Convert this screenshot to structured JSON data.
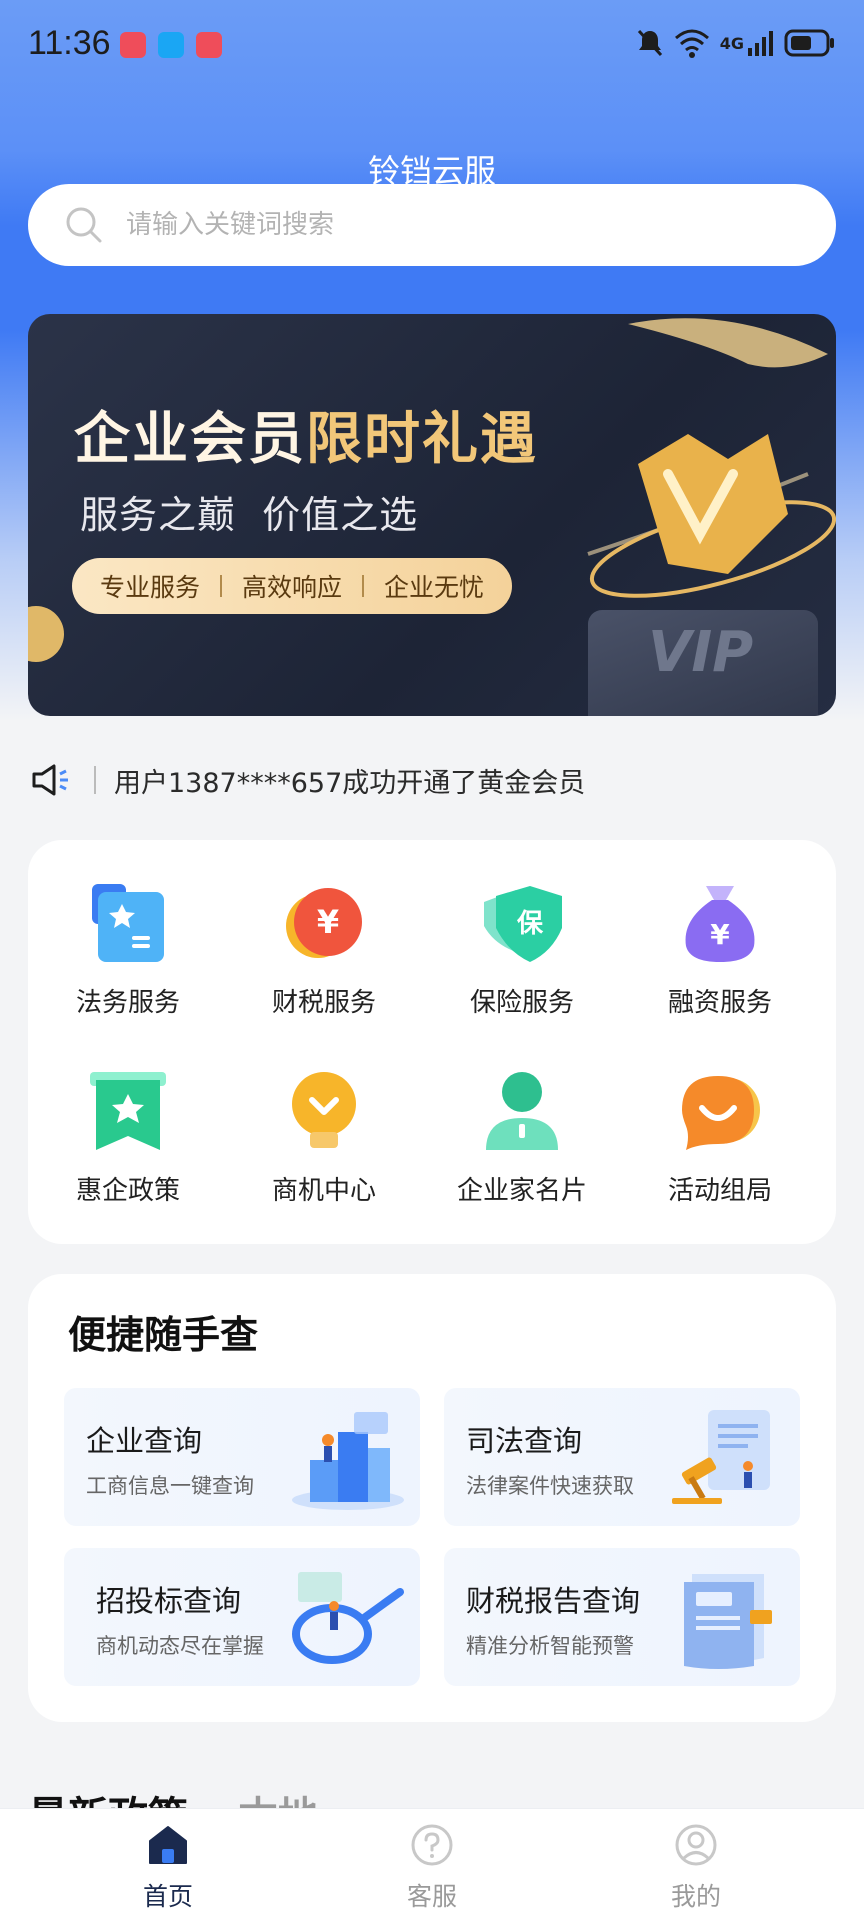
{
  "status_bar": {
    "time": "11:36",
    "network": "4G",
    "signal_small": "6"
  },
  "header": {
    "title": "铃铛云服"
  },
  "search": {
    "placeholder": "请输入关键词搜索"
  },
  "banner": {
    "title_part1": "企业会员",
    "title_part2": "限时礼遇",
    "subtitle": "服务之巅  价值之选",
    "tags": [
      "专业服务",
      "高效响应",
      "企业无忧"
    ],
    "badge_text": "VIP"
  },
  "notice": {
    "text": "用户1387****657成功开通了黄金会员"
  },
  "services": [
    {
      "label": "法务服务",
      "icon": "legal-card-icon",
      "color": "#4fb3f7"
    },
    {
      "label": "财税服务",
      "icon": "yuan-coin-icon",
      "color": "#f0553d"
    },
    {
      "label": "保险服务",
      "icon": "insurance-shield-icon",
      "color": "#2bcfa3"
    },
    {
      "label": "融资服务",
      "icon": "money-bag-icon",
      "color": "#8a6cf2"
    },
    {
      "label": "惠企政策",
      "icon": "star-bookmark-icon",
      "color": "#29c98e"
    },
    {
      "label": "商机中心",
      "icon": "lightbulb-icon",
      "color": "#f7b52a"
    },
    {
      "label": "企业家名片",
      "icon": "person-icon",
      "color": "#2ebf8f"
    },
    {
      "label": "活动组局",
      "icon": "smile-bubble-icon",
      "color": "#f58a2a"
    }
  ],
  "quick_query": {
    "title": "便捷随手查",
    "cards": [
      {
        "title": "企业查询",
        "subtitle": "工商信息一键查询"
      },
      {
        "title": "司法查询",
        "subtitle": "法律案件快速获取"
      },
      {
        "title": "招投标查询",
        "subtitle": "商机动态尽在掌握"
      },
      {
        "title": "财税报告查询",
        "subtitle": "精准分析智能预警"
      }
    ]
  },
  "policy": {
    "tab_latest": "最新政策",
    "tab_local": "本地"
  },
  "tabbar": {
    "items": [
      {
        "label": "首页",
        "active": true
      },
      {
        "label": "客服",
        "active": false
      },
      {
        "label": "我的",
        "active": false
      }
    ],
    "active_color": "#1b2a4e",
    "inactive_color": "#9a9a9a"
  },
  "colors": {
    "primary_blue": "#3f7af4",
    "gold": "#f2c779"
  }
}
